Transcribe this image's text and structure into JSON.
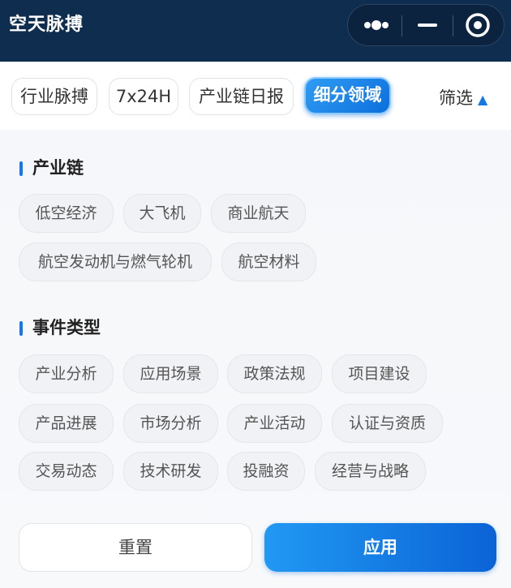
{
  "header": {
    "title": "空天脉搏"
  },
  "tabs": [
    {
      "label": "行业脉搏"
    },
    {
      "label": "7x24H"
    },
    {
      "label": "产业链日报"
    },
    {
      "label": "细分领域",
      "active": true
    }
  ],
  "filter": {
    "label": "筛选",
    "arrow": "▲"
  },
  "sections": [
    {
      "title": "产业链",
      "chips": [
        "低空经济",
        "大飞机",
        "商业航天",
        "航空发动机与燃气轮机",
        "航空材料"
      ]
    },
    {
      "title": "事件类型",
      "chips": [
        "产业分析",
        "应用场景",
        "政策法规",
        "项目建设",
        "产品进展",
        "市场分析",
        "产业活动",
        "认证与资质",
        "交易动态",
        "技术研发",
        "投融资",
        "经营与战略"
      ]
    }
  ],
  "actions": {
    "reset_label": "重置",
    "apply_label": "应用"
  },
  "icons": {
    "more": "more-dots-icon",
    "minimize": "minimize-icon",
    "close": "target-close-icon"
  },
  "colors": {
    "navbar": "#0f2d4e",
    "accent": "#1677e6"
  }
}
